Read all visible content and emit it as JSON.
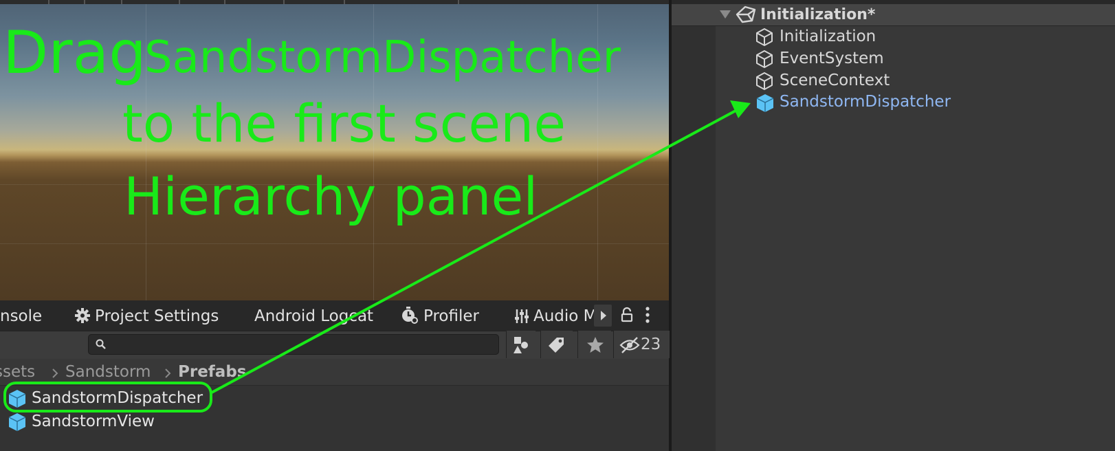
{
  "scene_view": {
    "instruction": {
      "word_drag": "Drag",
      "object_name": "SandstormDispatcher",
      "line2": "to the first scene",
      "line3": "Hierarchy panel",
      "color": "#19ea19"
    }
  },
  "project_panel": {
    "tabs": [
      {
        "label": "nsole"
      },
      {
        "label": "Project Settings",
        "icon": "gear-icon"
      },
      {
        "label": "Android Logcat"
      },
      {
        "label": "Profiler",
        "icon": "stopwatch-icon"
      },
      {
        "label": "Audio M",
        "icon": "audio-mixer-icon"
      }
    ],
    "search": {
      "value": "",
      "placeholder": ""
    },
    "hidden_count": "23",
    "breadcrumb": [
      "ssets",
      "Sandstorm",
      "Prefabs"
    ],
    "files": [
      {
        "name": "SandstormDispatcher",
        "icon": "prefab-cube-icon"
      },
      {
        "name": "SandstormView",
        "icon": "prefab-cube-icon"
      }
    ]
  },
  "hierarchy": {
    "scene_name": "Initialization*",
    "items": [
      {
        "name": "Initialization",
        "icon": "gameobject-cube-icon"
      },
      {
        "name": "EventSystem",
        "icon": "gameobject-cube-icon"
      },
      {
        "name": "SceneContext",
        "icon": "gameobject-cube-icon"
      },
      {
        "name": "SandstormDispatcher",
        "icon": "prefab-cube-icon"
      }
    ]
  },
  "colors": {
    "annotation_green": "#19ea19",
    "prefab_blue": "#5bc3f5",
    "prefab_text_blue": "#8fb7f2"
  }
}
